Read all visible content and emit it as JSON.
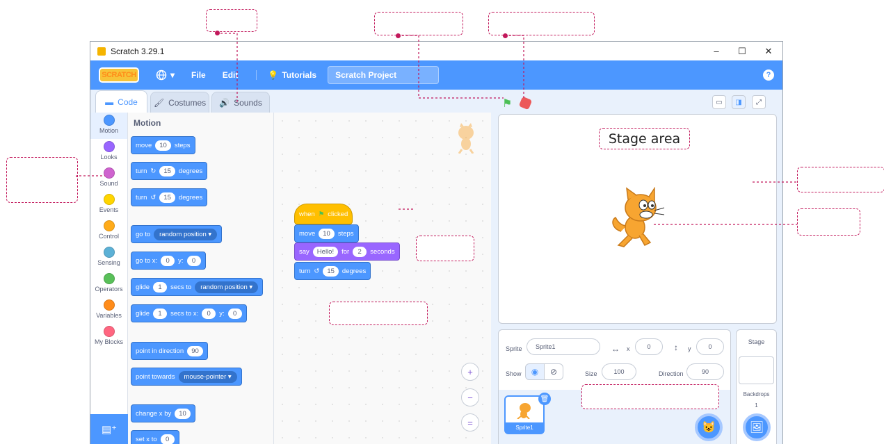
{
  "app": {
    "title": "Scratch 3.29.1"
  },
  "window_controls": {
    "minimize": "–",
    "maximize": "☐",
    "close": "✕"
  },
  "menubar": {
    "logo": "SCRATCH",
    "file": "File",
    "edit": "Edit",
    "tutorials": "Tutorials",
    "project_title": "Scratch Project",
    "help": "?"
  },
  "tabs": [
    {
      "label": "Code",
      "icon": "code-icon"
    },
    {
      "label": "Costumes",
      "icon": "brush-icon"
    },
    {
      "label": "Sounds",
      "icon": "speaker-icon"
    }
  ],
  "categories": [
    {
      "label": "Motion",
      "color": "#4c97ff"
    },
    {
      "label": "Looks",
      "color": "#9966ff"
    },
    {
      "label": "Sound",
      "color": "#cf63cf"
    },
    {
      "label": "Events",
      "color": "#ffd500"
    },
    {
      "label": "Control",
      "color": "#ffab19"
    },
    {
      "label": "Sensing",
      "color": "#5cb1d6"
    },
    {
      "label": "Operators",
      "color": "#59c059"
    },
    {
      "label": "Variables",
      "color": "#ff8c1a"
    },
    {
      "label": "My Blocks",
      "color": "#ff6680"
    }
  ],
  "palette": {
    "title": "Motion",
    "move": {
      "a": "move",
      "v": "10",
      "b": "steps"
    },
    "turn_right": {
      "a": "turn",
      "v": "15",
      "b": "degrees"
    },
    "turn_left": {
      "a": "turn",
      "v": "15",
      "b": "degrees"
    },
    "goto": {
      "a": "go to",
      "d": "random position ▾"
    },
    "gotoxy": {
      "a": "go to x:",
      "x": "0",
      "b": "y:",
      "y": "0"
    },
    "glide_to": {
      "a": "glide",
      "v": "1",
      "b": "secs to",
      "d": "random position ▾"
    },
    "glide_xy": {
      "a": "glide",
      "v": "1",
      "b": "secs to x:",
      "x": "0",
      "c": "y:",
      "y": "0"
    },
    "point_dir": {
      "a": "point in direction",
      "v": "90"
    },
    "point_towards": {
      "a": "point towards",
      "d": "mouse-pointer ▾"
    },
    "change_x": {
      "a": "change x by",
      "v": "10"
    },
    "set_x": {
      "a": "set x to",
      "v": "0"
    }
  },
  "script": {
    "hat": {
      "a": "when",
      "b": "clicked"
    },
    "move": {
      "a": "move",
      "v": "10",
      "b": "steps"
    },
    "say": {
      "a": "say",
      "v": "Hello!",
      "b": "for",
      "s": "2",
      "c": "seconds"
    },
    "turn": {
      "a": "turn",
      "v": "15",
      "b": "degrees"
    }
  },
  "zoom": {
    "in": "+",
    "out": "−",
    "reset": "="
  },
  "stage": {
    "label": "Stage area"
  },
  "sprite_info": {
    "sprite_label": "Sprite",
    "sprite_name": "Sprite1",
    "x_label": "x",
    "x": "0",
    "y_label": "y",
    "y": "0",
    "show_label": "Show",
    "size_label": "Size",
    "size": "100",
    "direction_label": "Direction",
    "direction": "90"
  },
  "sprite_list": [
    {
      "name": "Sprite1"
    }
  ],
  "stage_pane": {
    "title": "Stage",
    "backdrops_label": "Backdrops",
    "backdrops_count": "1"
  },
  "colors": {
    "accent": "#4c97ff",
    "annotation": "#c2185b",
    "events": "#ffbf00",
    "looks": "#9966ff"
  }
}
